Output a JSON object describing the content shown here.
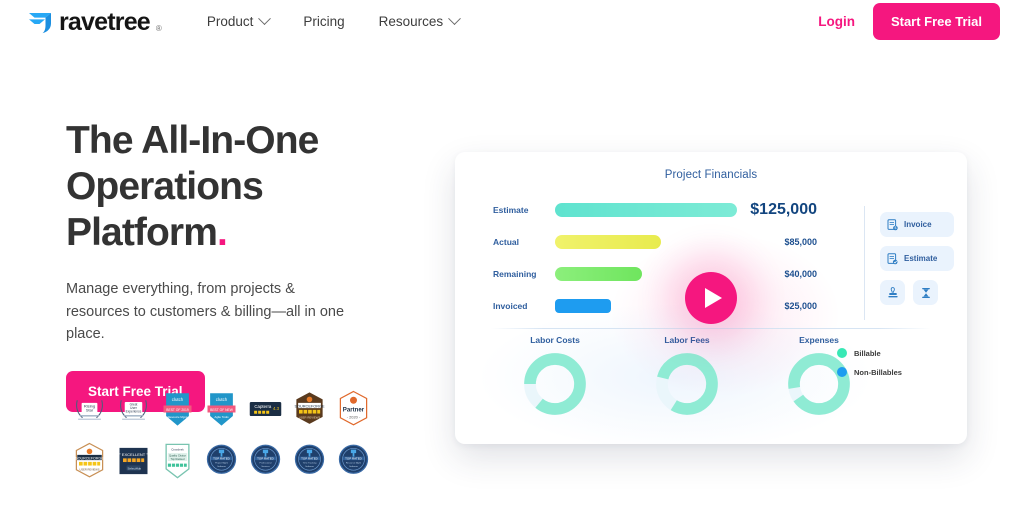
{
  "header": {
    "brand": {
      "name": "ravetree",
      "trademark": "®",
      "icon": "ravetree-logo-icon"
    },
    "nav": [
      {
        "label": "Product",
        "has_dropdown": true
      },
      {
        "label": "Pricing",
        "has_dropdown": false
      },
      {
        "label": "Resources",
        "has_dropdown": true
      }
    ],
    "login_label": "Login",
    "cta_label": "Start Free Trial"
  },
  "hero": {
    "title_line1": "The All-In-One",
    "title_line2": "Operations",
    "title_line3": "Platform",
    "title_period": ".",
    "subtitle": "Manage everything, from projects & resources to customers & billing—all in one place.",
    "cta_label": "Start Free Trial"
  },
  "colors": {
    "accent_pink": "#F5177F",
    "title_dark": "#333333",
    "chart_blue_text": "#2f5e9e",
    "estimate_bar": "#5FE3CF",
    "actual_bar": "#EDEF5A",
    "remaining_bar": "#79E86A",
    "invoiced_bar": "#1E9CF0",
    "billable": "#38E8B5",
    "non_billable": "#1E9CF0",
    "donut_teal": "#8FEBD4"
  },
  "dashboard": {
    "title": "Project Financials",
    "play_button": "play-icon",
    "side_actions": [
      {
        "label": "Invoice",
        "icon": "invoice-document-icon"
      },
      {
        "label": "Estimate",
        "icon": "estimate-document-icon"
      }
    ],
    "icon_actions": [
      {
        "icon": "stamp-icon"
      },
      {
        "icon": "hourglass-icon"
      }
    ],
    "legend": [
      {
        "label": "Billable",
        "color": "#38E8B5"
      },
      {
        "label": "Non-Billables",
        "color": "#1E9CF0"
      }
    ]
  },
  "chart_data": [
    {
      "type": "bar",
      "title": "Project Financials",
      "orientation": "horizontal",
      "categories": [
        "Estimate",
        "Actual",
        "Remaining",
        "Invoiced"
      ],
      "values": [
        125000,
        85000,
        40000,
        25000
      ],
      "value_labels": [
        "$125,000",
        "$85,000",
        "$40,000",
        "$25,000"
      ],
      "colors": [
        "#5FE3CF",
        "#EDEF5A",
        "#79E86A",
        "#1E9CF0"
      ],
      "xlabel": "",
      "ylabel": "",
      "xlim": [
        0,
        125000
      ],
      "grid": false
    },
    {
      "type": "pie",
      "title": "Labor Costs",
      "labels": [
        "Billable",
        "Non-Billables"
      ],
      "values": [
        86,
        14
      ],
      "colors": [
        "#8FEBD4",
        "#D8F3EC"
      ],
      "donut": true
    },
    {
      "type": "pie",
      "title": "Labor Fees",
      "labels": [
        "Billable",
        "Non-Billables"
      ],
      "values": [
        80,
        20
      ],
      "colors": [
        "#8FEBD4",
        "#D8F3EC"
      ],
      "donut": true
    },
    {
      "type": "pie",
      "title": "Expenses",
      "labels": [
        "Billable",
        "Non-Billables"
      ],
      "values": [
        93,
        7
      ],
      "colors": [
        "#8FEBD4",
        "#D8F3EC"
      ],
      "donut": true
    }
  ],
  "awards": {
    "row1": [
      {
        "name": "rising-star-award-badge",
        "text": "Rising Star"
      },
      {
        "name": "great-user-experience-award-badge",
        "text": "Great User Experience"
      },
      {
        "name": "clutch-best-of-2019-badge",
        "text": "clutch BEST OF 2019"
      },
      {
        "name": "clutch-best-of-new-agile-tools-badge",
        "text": "clutch BEST OF NEW Agile Tools"
      },
      {
        "name": "capterra-rating-badge",
        "text": "Capterra 4.3"
      },
      {
        "name": "sourceforge-five-star-badge",
        "text": "SOURCEFORGE"
      },
      {
        "name": "partner-2020-badge",
        "text": "Partner 2020"
      }
    ],
    "row2": [
      {
        "name": "sourceforge-user-reviews-badge",
        "text": "SOURCEFORGE USER REVIEWS"
      },
      {
        "name": "excellent-rating-badge",
        "text": "EXCELLENT"
      },
      {
        "name": "crozdesk-quality-choice-badge",
        "text": "Crozdesk Quality Choice"
      },
      {
        "name": "top-rated-badge-1",
        "text": "TOP RATED"
      },
      {
        "name": "top-rated-badge-2",
        "text": "TOP RATED"
      },
      {
        "name": "top-rated-badge-3",
        "text": "TOP RATED"
      },
      {
        "name": "top-rated-badge-4",
        "text": "TOP RATED"
      }
    ]
  }
}
